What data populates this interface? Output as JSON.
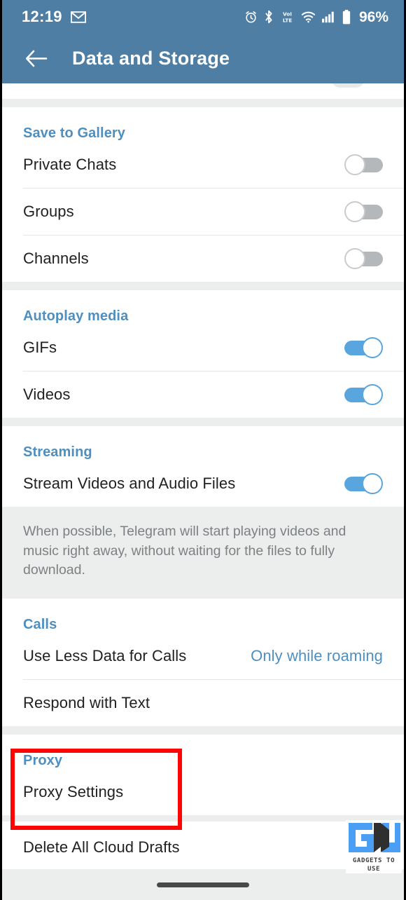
{
  "status_bar": {
    "time": "12:19",
    "battery_percent": "96%",
    "icons": [
      "gmail-icon",
      "alarm-icon",
      "bluetooth-icon",
      "volte-icon",
      "wifi-icon",
      "cellular-signal-icon",
      "battery-icon"
    ]
  },
  "app_bar": {
    "back_label": "←",
    "title": "Data and Storage"
  },
  "colors": {
    "header_blue": "#4e7ea3",
    "accent_blue": "#4e8fbf",
    "toggle_on": "#58a6dd",
    "toggle_off": "#b5b8ba",
    "highlight_red": "#fb0505",
    "page_background": "#eceded",
    "card_background": "#ffffff",
    "primary_text": "#212121",
    "secondary_text": "#7d8184"
  },
  "sections": [
    {
      "header": "Save to Gallery",
      "rows": [
        {
          "label": "Private Chats",
          "control": "toggle",
          "state": "off"
        },
        {
          "label": "Groups",
          "control": "toggle",
          "state": "off"
        },
        {
          "label": "Channels",
          "control": "toggle",
          "state": "off"
        }
      ]
    },
    {
      "header": "Autoplay media",
      "rows": [
        {
          "label": "GIFs",
          "control": "toggle",
          "state": "on"
        },
        {
          "label": "Videos",
          "control": "toggle",
          "state": "on"
        }
      ]
    },
    {
      "header": "Streaming",
      "rows": [
        {
          "label": "Stream Videos and Audio Files",
          "control": "toggle",
          "state": "on"
        }
      ],
      "footer": "When possible, Telegram will start playing videos and music right away, without waiting for the files to fully download."
    },
    {
      "header": "Calls",
      "rows": [
        {
          "label": "Use Less Data for Calls",
          "control": "value",
          "value": "Only while roaming"
        },
        {
          "label": "Respond with Text",
          "control": "none"
        }
      ]
    },
    {
      "header": "Proxy",
      "highlighted": true,
      "rows": [
        {
          "label": "Proxy Settings",
          "control": "none"
        }
      ]
    },
    {
      "header": "",
      "rows": [
        {
          "label": "Delete All Cloud Drafts",
          "control": "none"
        }
      ]
    }
  ],
  "watermark": {
    "label": "GADGETS TO USE",
    "blue": "#4a9ff5",
    "dark": "#2f2f2f"
  },
  "nav_bar": {
    "type": "gesture-pill"
  }
}
